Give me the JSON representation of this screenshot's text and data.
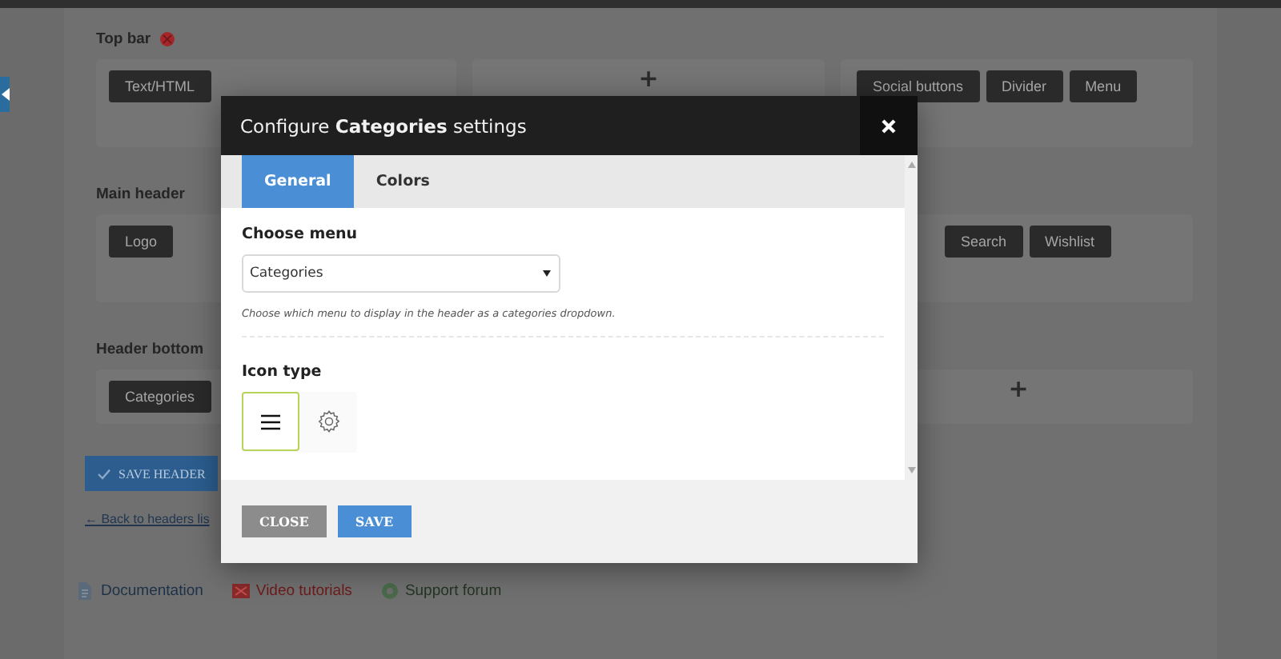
{
  "builder": {
    "sections": [
      {
        "title": "Top bar",
        "warning": true,
        "columns": [
          {
            "modules": [
              {
                "label": "Text/HTML"
              }
            ]
          },
          {
            "add": "+"
          },
          {
            "modules": [
              {
                "label": "Social buttons"
              },
              {
                "label": "Divider"
              },
              {
                "label": "Menu"
              }
            ]
          }
        ]
      },
      {
        "title": "Main header",
        "warning": false,
        "columns": [
          {
            "modules": [
              {
                "label": "Logo"
              }
            ]
          },
          {},
          {
            "modules": [
              {
                "label": "Search"
              },
              {
                "label": "Wishlist"
              }
            ]
          }
        ]
      },
      {
        "title": "Header bottom",
        "warning": false,
        "columns": [
          {
            "modules": [
              {
                "label": "Categories"
              }
            ]
          },
          {},
          {
            "add": "+"
          }
        ]
      }
    ],
    "save_button": "SAVE HEADER",
    "back_link": "← Back to headers lis",
    "footer_links": [
      {
        "label": "Documentation",
        "kind": "doc"
      },
      {
        "label": "Video tutorials",
        "kind": "video"
      },
      {
        "label": "Support forum",
        "kind": "support"
      }
    ]
  },
  "modal": {
    "title": "Configure **Categories** settings",
    "tabs": [
      {
        "label": "General",
        "selected": true
      },
      {
        "label": "Colors",
        "selected": false
      }
    ],
    "fields": [
      {
        "kind": "select",
        "label": "Choose menu",
        "value": "Categories",
        "help": "Choose which menu to display in the header as a categories dropdown."
      },
      {
        "kind": "icon_choice",
        "label": "Icon type",
        "options": [
          {
            "kind": "lines",
            "selected": true
          },
          {
            "kind": "gear",
            "selected": false
          }
        ]
      }
    ],
    "buttons": [
      {
        "label": "CLOSE",
        "kind": "secondary"
      },
      {
        "label": "SAVE",
        "kind": "primary"
      }
    ]
  }
}
